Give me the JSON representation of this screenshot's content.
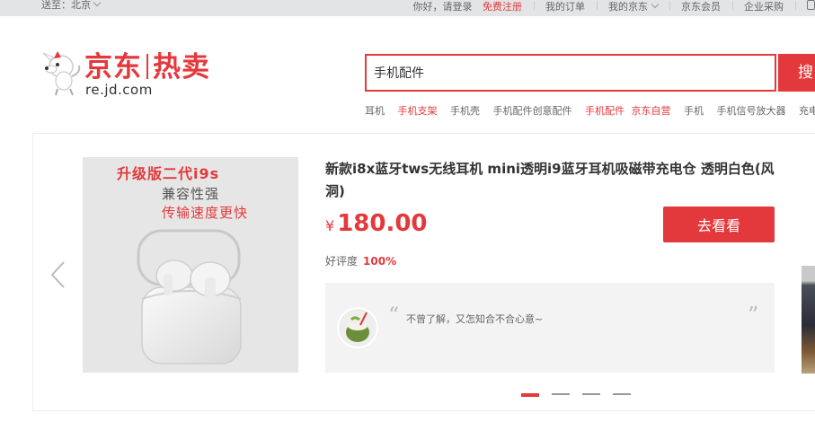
{
  "topbar": {
    "location_label": "送至：北京",
    "greeting": "你好，请登录",
    "register": "免费注册",
    "my_orders": "我的订单",
    "my_jd": "我的京东",
    "membership": "京东会员",
    "enterprise": "企业采购"
  },
  "logo": {
    "brand_jd": "京东",
    "brand_hot": "热卖",
    "url": "re.jd.com"
  },
  "search": {
    "value": "手机配件",
    "button_label": "搜"
  },
  "hotwords": [
    {
      "text": "耳机",
      "highlight": false
    },
    {
      "text": "手机支架",
      "highlight": true
    },
    {
      "text": "手机壳",
      "highlight": false
    },
    {
      "text": "手机配件创意配件",
      "highlight": false
    },
    {
      "text": "手机配件",
      "highlight": true
    },
    {
      "text": "京东自营",
      "highlight": true
    },
    {
      "text": "手机",
      "highlight": false
    },
    {
      "text": "手机信号放大器",
      "highlight": false
    },
    {
      "text": "充电",
      "highlight": false
    }
  ],
  "product": {
    "image_text": {
      "line1": "升级版二代i9s",
      "line2": "兼容性强",
      "line3": "传输速度更快"
    },
    "title": "新款i8x蓝牙tws无线耳机 mini透明i9蓝牙耳机吸磁带充电仓 透明白色(风洞)",
    "currency": "¥",
    "price": "180.00",
    "button_label": "去看看",
    "rating_label": "好评度",
    "rating_value": "100%",
    "review_text": "不曾了解，又怎知合不合心意~"
  },
  "carousel": {
    "total": 4,
    "active": 0
  },
  "colors": {
    "accent": "#e4393c",
    "topbar_bg": "#e3e4e5",
    "review_bg": "#f3f3f3"
  },
  "icons": [
    "jd-dog-logo-icon",
    "chevron-down-icon",
    "phone-icon",
    "chevron-left-icon",
    "avatar-coconut-icon",
    "quote-icon"
  ]
}
